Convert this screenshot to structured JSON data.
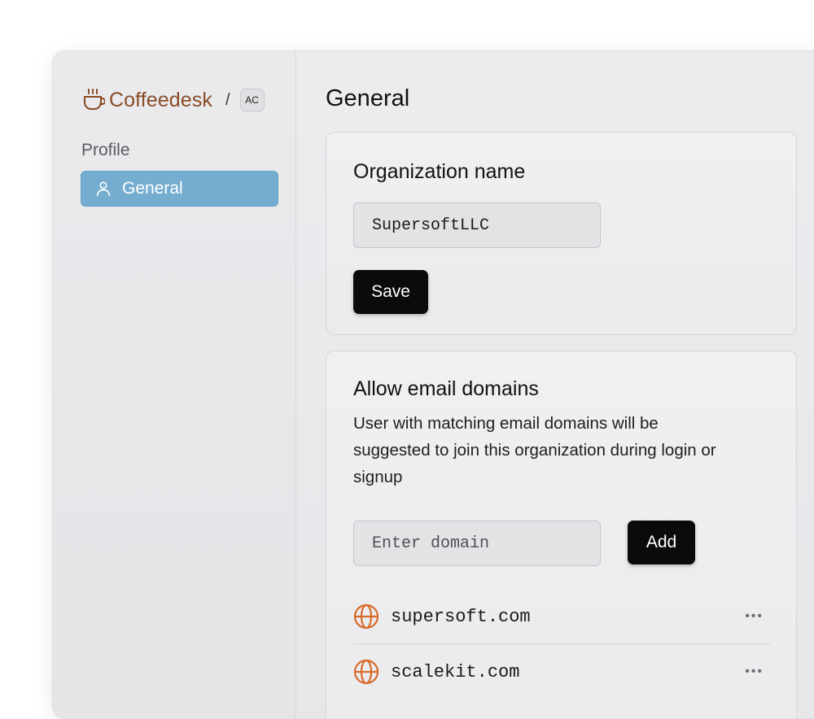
{
  "brand": {
    "name": "Coffeedesk",
    "separator": "/",
    "avatar": "AC",
    "icon": "coffee-cup-icon",
    "accent": "#8a4b27"
  },
  "sidebar": {
    "section_label": "Profile",
    "items": [
      {
        "label": "General",
        "icon": "user-icon",
        "active": true
      }
    ]
  },
  "page": {
    "title": "General"
  },
  "org_card": {
    "title": "Organization name",
    "input_value": "SupersoftLLC",
    "save_label": "Save"
  },
  "domains_card": {
    "title": "Allow email domains",
    "description": "User with matching email domains will be suggested to join this organization during login or signup",
    "input_placeholder": "Enter domain",
    "add_label": "Add",
    "domains": [
      {
        "name": "supersoft.com",
        "icon": "globe-icon",
        "menu": "•••"
      },
      {
        "name": "scalekit.com",
        "icon": "globe-icon",
        "menu": "•••"
      }
    ]
  },
  "colors": {
    "active_nav": "#74adcf",
    "globe": "#d86b2c",
    "button": "#0b0b0b"
  }
}
